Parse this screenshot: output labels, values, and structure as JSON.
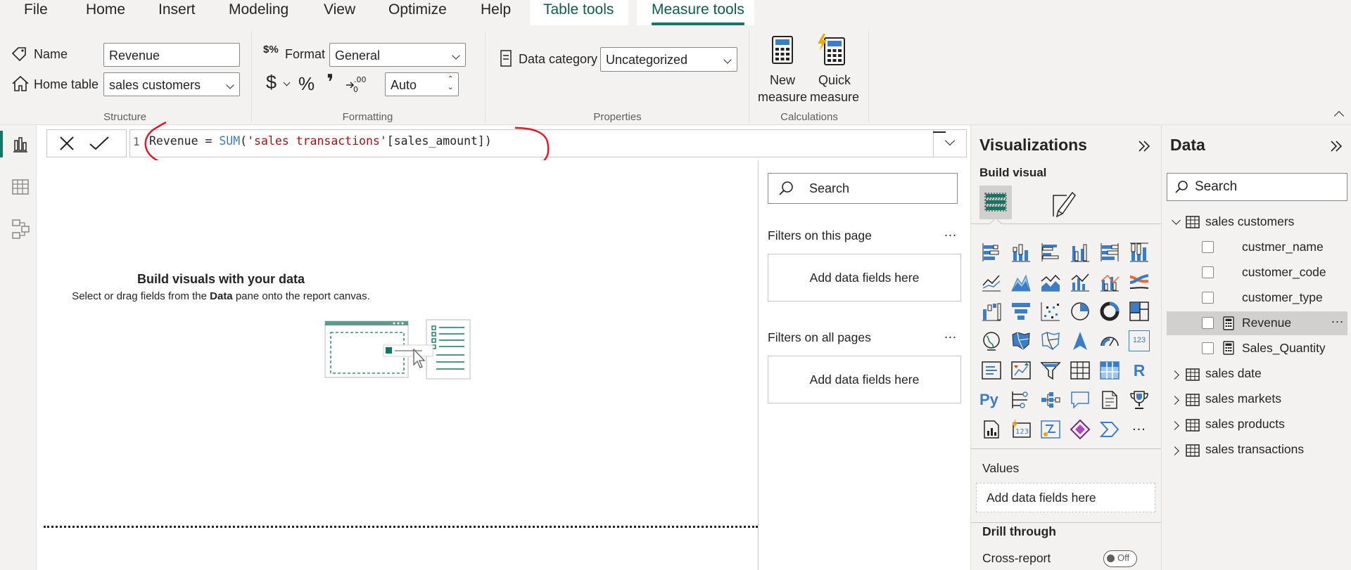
{
  "menu": {
    "items": [
      {
        "label": "File"
      },
      {
        "label": "Home"
      },
      {
        "label": "Insert"
      },
      {
        "label": "Modeling"
      },
      {
        "label": "View"
      },
      {
        "label": "Optimize"
      },
      {
        "label": "Help"
      },
      {
        "label": "Table tools"
      },
      {
        "label": "Measure tools"
      }
    ],
    "active": "Measure tools"
  },
  "ribbon": {
    "structure": {
      "name_label": "Name",
      "name_value": "Revenue",
      "home_table_label": "Home table",
      "home_table_value": "sales customers",
      "group_label": "Structure"
    },
    "formatting": {
      "format_label": "Format",
      "format_value": "General",
      "currency_symbol": "$",
      "percent_symbol": "%",
      "comma_symbol": "❜",
      "decimals_value": "Auto",
      "group_label": "Formatting"
    },
    "properties": {
      "data_category_label": "Data category",
      "data_category_value": "Uncategorized",
      "group_label": "Properties"
    },
    "calculations": {
      "new_measure_line1": "New",
      "new_measure_line2": "measure",
      "quick_measure_line1": "Quick",
      "quick_measure_line2": "measure",
      "group_label": "Calculations"
    }
  },
  "formula": {
    "line_number": "1",
    "measure_name": "Revenue",
    "equals": " = ",
    "func": "SUM",
    "open_paren": "(",
    "table_ref": "'sales transactions'",
    "column_ref": "[sales_amount]",
    "close_paren": ")"
  },
  "canvas": {
    "heading": "Build visuals with your data",
    "subtext_before": "Select or drag fields from the ",
    "subtext_bold": "Data",
    "subtext_after": " pane onto the report canvas."
  },
  "filters": {
    "search_placeholder": "Search",
    "page_section": "Filters on this page",
    "page_drop": "Add data fields here",
    "all_section": "Filters on all pages",
    "all_drop": "Add data fields here",
    "more": "..."
  },
  "visualizations": {
    "title": "Visualizations",
    "build_visual": "Build visual",
    "values_label": "Values",
    "values_drop": "Add data fields here",
    "drill_through": "Drill through",
    "cross_report": "Cross-report",
    "toggle_state": "Off",
    "r_label": "R",
    "py_label": "Py",
    "num_label": "123",
    "more": "..."
  },
  "data": {
    "title": "Data",
    "search_placeholder": "Search",
    "tables": [
      {
        "name": "sales customers",
        "expanded": true
      },
      {
        "name": "sales date",
        "expanded": false
      },
      {
        "name": "sales markets",
        "expanded": false
      },
      {
        "name": "sales products",
        "expanded": false
      },
      {
        "name": "sales transactions",
        "expanded": false
      }
    ],
    "fields": [
      {
        "name": "custmer_name"
      },
      {
        "name": "customer_code"
      },
      {
        "name": "customer_type"
      },
      {
        "name": "Revenue",
        "selected": true
      },
      {
        "name": "Sales_Quantity"
      }
    ],
    "more": "..."
  },
  "colors": {
    "accent": "#117865",
    "annotation": "#e81123",
    "code_func": "#3b7ec7",
    "code_string": "#a31515"
  }
}
